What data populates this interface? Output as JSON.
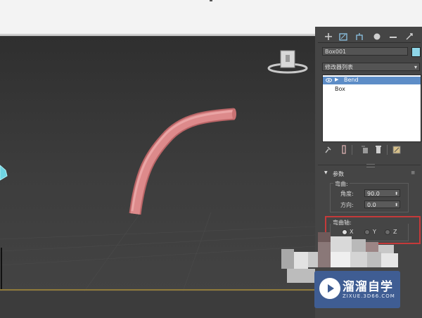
{
  "command_panel": {
    "object_name": "Box001",
    "modifier_list_label": "修改器列表",
    "stack_items": [
      "Bend",
      "Box"
    ]
  },
  "parameters": {
    "title": "参数",
    "bend_group": "弯曲:",
    "angle_label": "角度:",
    "angle_value": "90.0",
    "direction_label": "方向:",
    "direction_value": "0.0",
    "axis_group": "弯曲轴:",
    "axis_options": [
      "X",
      "Y",
      "Z"
    ]
  },
  "watermark": {
    "brand": "溜溜自学",
    "url": "ZIXUE.3D66.COM"
  },
  "colors": {
    "object_color": "#8fd6e8",
    "tube_color": "#d98384",
    "highlight": "#c43a3a",
    "selection": "#5d8dc7"
  }
}
